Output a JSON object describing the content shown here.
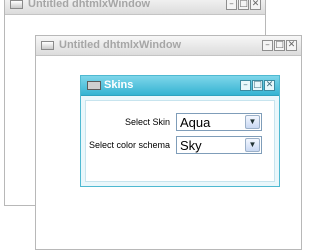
{
  "window1": {
    "title": "Untitled dhtmlxWindow"
  },
  "window2": {
    "title": "Untitled dhtmlxWindow"
  },
  "skins_window": {
    "title": "Skins",
    "skin_label": "Select Skin",
    "skin_value": "Aqua",
    "schema_label": "Select color schema",
    "schema_value": "Sky"
  },
  "buttons": {
    "minimize": "–",
    "maximize": "□",
    "close": "✕"
  },
  "icons": [
    "window-icon",
    "minimize-icon",
    "maximize-icon",
    "close-icon",
    "dropdown-arrow-icon"
  ],
  "colors": {
    "aqua_titlebar": "#34b3d2",
    "inactive_title": "#a6a6a6"
  }
}
